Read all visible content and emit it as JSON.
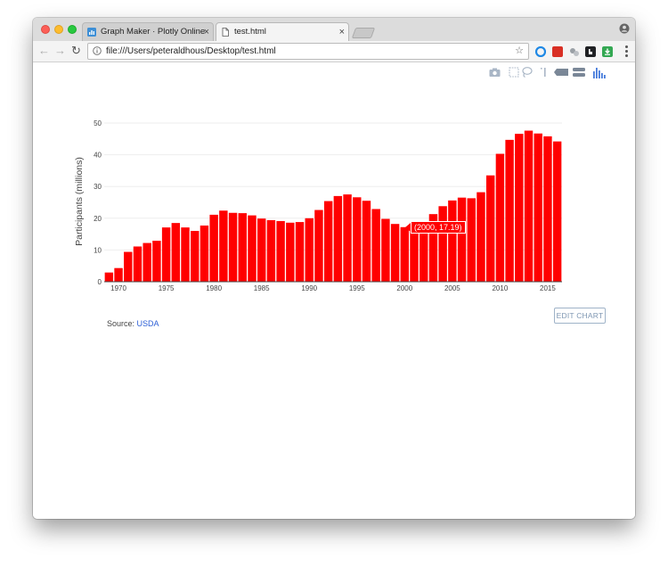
{
  "browser": {
    "tabs": [
      {
        "label": "Graph Maker · Plotly Online",
        "active": false
      },
      {
        "label": "test.html",
        "active": true
      }
    ],
    "tab_close": "×",
    "nav": {
      "back": "←",
      "forward": "→",
      "reload": "↻"
    },
    "url": "file:///Users/peteraldhous/Desktop/test.html",
    "bookmark": "☆",
    "extension_colors": [
      "#1e88e5",
      "#d93025",
      "#9aa0a6",
      "#202124",
      "#34a853"
    ]
  },
  "modebar": {
    "icons": [
      "camera-icon",
      "zoom-box-icon",
      "lasso-icon",
      "spike-lines-icon",
      "compare-hover-icon",
      "closest-hover-icon",
      "plotly-logo-icon"
    ]
  },
  "page": {
    "source_label": "Source: ",
    "source_link": "USDA",
    "edit_button": "EDIT CHART",
    "tooltip": "(2000, 17.19)"
  },
  "chart_data": {
    "type": "bar",
    "ylabel": "Participants (millions)",
    "xlabel": "",
    "ylim": [
      0,
      50
    ],
    "xlim": [
      1968.5,
      2016.5
    ],
    "yticks": [
      0,
      10,
      20,
      30,
      40,
      50
    ],
    "xticks": [
      1970,
      1975,
      1980,
      1985,
      1990,
      1995,
      2000,
      2005,
      2010,
      2015
    ],
    "grid": true,
    "bar_color": "#ff0000",
    "x": [
      1969,
      1970,
      1971,
      1972,
      1973,
      1974,
      1975,
      1976,
      1977,
      1978,
      1979,
      1980,
      1981,
      1982,
      1983,
      1984,
      1985,
      1986,
      1987,
      1988,
      1989,
      1990,
      1991,
      1992,
      1993,
      1994,
      1995,
      1996,
      1997,
      1998,
      1999,
      2000,
      2001,
      2002,
      2003,
      2004,
      2005,
      2006,
      2007,
      2008,
      2009,
      2010,
      2011,
      2012,
      2013,
      2014,
      2015,
      2016
    ],
    "values": [
      2.9,
      4.3,
      9.4,
      11.1,
      12.2,
      12.9,
      17.1,
      18.5,
      17.1,
      16.0,
      17.7,
      21.1,
      22.4,
      21.7,
      21.6,
      20.9,
      19.9,
      19.4,
      19.1,
      18.6,
      18.8,
      20.0,
      22.6,
      25.4,
      27.0,
      27.5,
      26.6,
      25.5,
      22.9,
      19.8,
      18.2,
      17.19,
      17.3,
      19.1,
      21.3,
      23.8,
      25.6,
      26.5,
      26.3,
      28.2,
      33.5,
      40.3,
      44.7,
      46.6,
      47.6,
      46.7,
      45.8,
      44.2
    ]
  }
}
